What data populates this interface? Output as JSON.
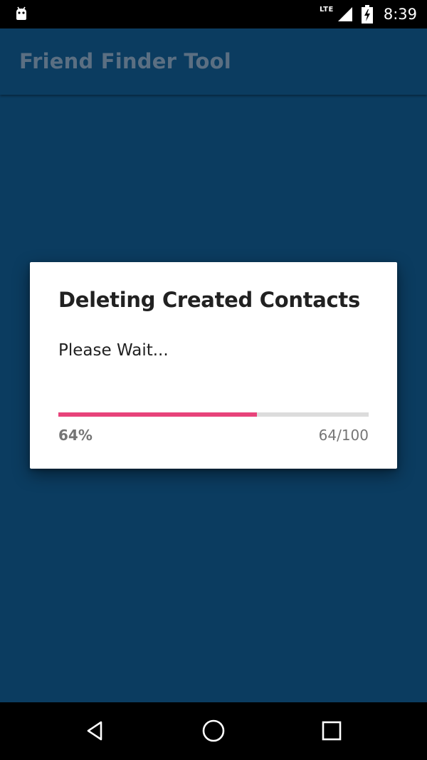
{
  "status_bar": {
    "network": "LTE",
    "time": "8:39",
    "icons": [
      "android-debug-icon",
      "signal-icon",
      "battery-charging-icon"
    ]
  },
  "toolbar": {
    "title": "Friend Finder Tool"
  },
  "dialog": {
    "title": "Deleting Created Contacts",
    "message": "Please Wait...",
    "progress": {
      "value": 64,
      "max": 100,
      "percent_label": "64%",
      "count_label": "64/100"
    }
  },
  "nav_bar": {
    "icons": [
      "back-icon",
      "home-icon",
      "recents-icon"
    ]
  },
  "colors": {
    "app_background": "#0b3c60",
    "toolbar_title": "#5b6f82",
    "progress_fill": "#e8437a",
    "progress_track": "#dcdcdc"
  }
}
